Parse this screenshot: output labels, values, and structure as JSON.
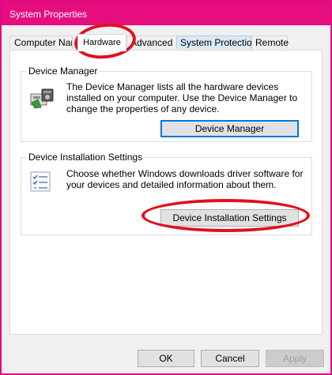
{
  "window": {
    "title": "System Properties"
  },
  "tabs": [
    {
      "label": "Computer Name"
    },
    {
      "label": "Hardware"
    },
    {
      "label": "Advanced"
    },
    {
      "label": "System Protection"
    },
    {
      "label": "Remote"
    }
  ],
  "device_manager": {
    "title": "Device Manager",
    "description": "The Device Manager lists all the hardware devices installed on your computer. Use the Device Manager to change the properties of any device.",
    "button_label": "Device Manager"
  },
  "device_installation": {
    "title": "Device Installation Settings",
    "description": "Choose whether Windows downloads driver software for your devices and detailed information about them.",
    "button_label": "Device Installation Settings"
  },
  "footer": {
    "ok_label": "OK",
    "cancel_label": "Cancel",
    "apply_label": "Apply"
  },
  "colors": {
    "titlebar": "#e60e7f",
    "annotation": "#e01020",
    "focus_border": "#0078d7"
  }
}
